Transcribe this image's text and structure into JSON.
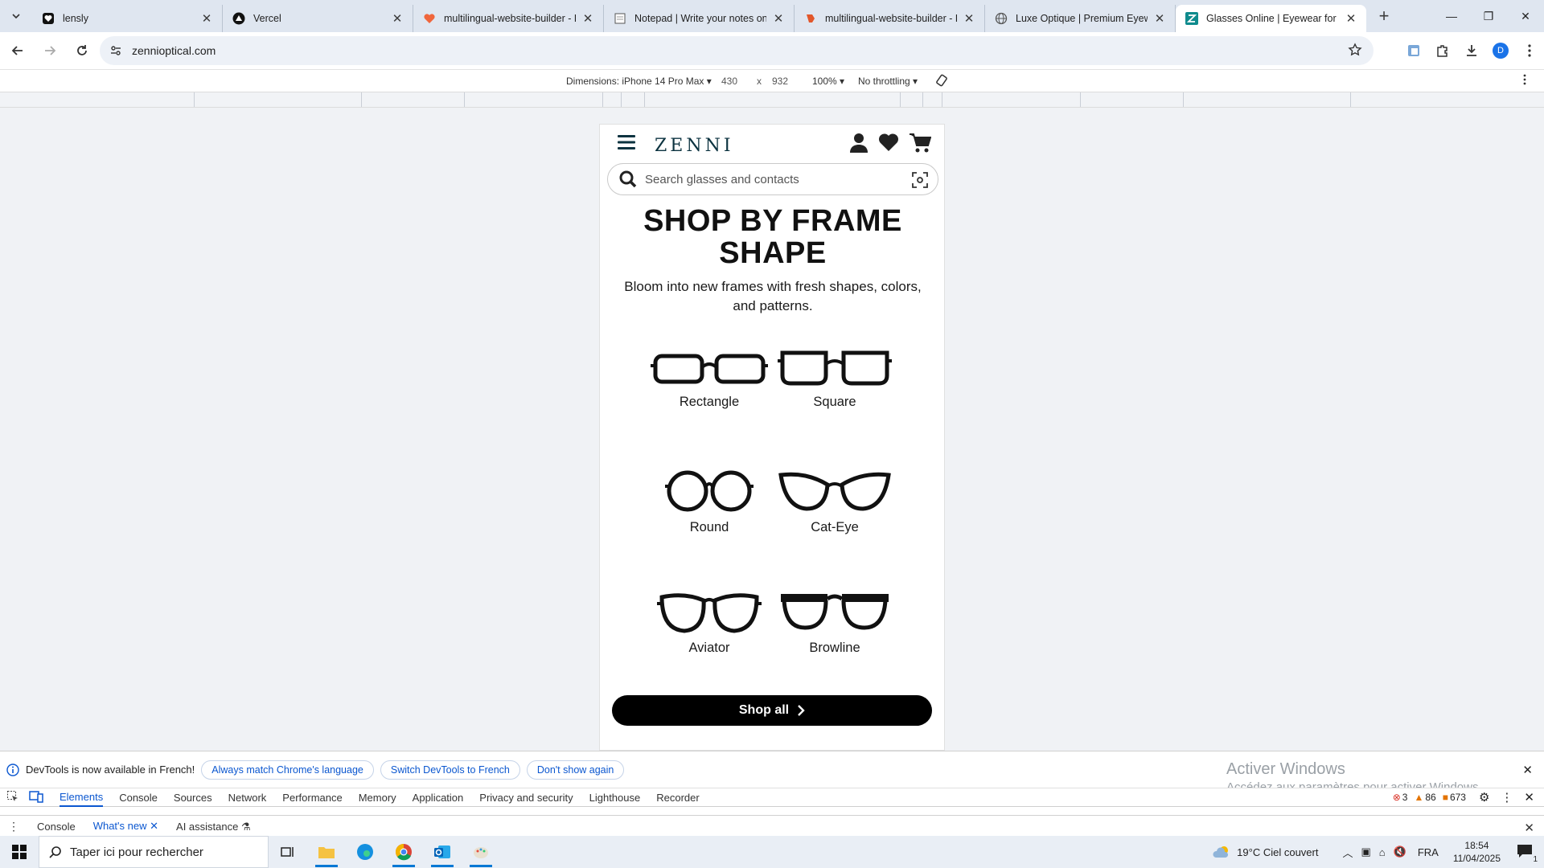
{
  "browser": {
    "tabs": [
      {
        "title": "lensly",
        "favicon": "heart-shield-icon",
        "active": false
      },
      {
        "title": "Vercel",
        "favicon": "vercel-triangle-icon",
        "active": false
      },
      {
        "title": "multilingual-website-builder - L",
        "favicon": "lovable-heart-icon",
        "active": false
      },
      {
        "title": "Notepad | Write your notes onl",
        "favicon": "notepad-icon",
        "active": false
      },
      {
        "title": "multilingual-website-builder - P",
        "favicon": "bolt-icon",
        "active": false
      },
      {
        "title": "Luxe Optique | Premium Eyewe",
        "favicon": "globe-icon",
        "active": false
      },
      {
        "title": "Glasses Online | Eyewear for Ev",
        "favicon": "zenni-icon",
        "active": true
      }
    ],
    "url": "zennioptical.com",
    "profile_initial": "D"
  },
  "device_toolbar": {
    "dimensions_label": "Dimensions: iPhone 14 Pro Max",
    "width": "430",
    "times": "x",
    "height": "932",
    "zoom": "100%",
    "throttling": "No throttling"
  },
  "site": {
    "logo": "ZENNI",
    "search_placeholder": "Search glasses and contacts",
    "headline": "SHOP BY FRAME SHAPE",
    "subline": "Bloom into new frames with fresh shapes, colors, and patterns.",
    "shapes": [
      {
        "label": "Rectangle",
        "icon": "rectangle-glasses-icon"
      },
      {
        "label": "Square",
        "icon": "square-glasses-icon"
      },
      {
        "label": "Round",
        "icon": "round-glasses-icon"
      },
      {
        "label": "Cat-Eye",
        "icon": "cat-eye-glasses-icon"
      },
      {
        "label": "Aviator",
        "icon": "aviator-glasses-icon"
      },
      {
        "label": "Browline",
        "icon": "browline-glasses-icon"
      }
    ],
    "shop_all": "Shop all"
  },
  "devtools": {
    "info_message": "DevTools is now available in French!",
    "info_buttons": [
      "Always match Chrome's language",
      "Switch DevTools to French",
      "Don't show again"
    ],
    "watermark_title": "Activer Windows",
    "watermark_sub": "Accédez aux paramètres pour activer Windows.",
    "tabs": [
      "Elements",
      "Console",
      "Sources",
      "Network",
      "Performance",
      "Memory",
      "Application",
      "Privacy and security",
      "Lighthouse",
      "Recorder"
    ],
    "active_tab": "Elements",
    "errors": "3",
    "warnings": "86",
    "issues": "673",
    "drawer_tabs": [
      "Console",
      "What's new",
      "AI assistance"
    ]
  },
  "taskbar": {
    "search_placeholder": "Taper ici pour rechercher",
    "weather": "19°C  Ciel couvert",
    "language": "FRA",
    "time": "18:54",
    "date": "11/04/2025",
    "notifications": "1"
  }
}
